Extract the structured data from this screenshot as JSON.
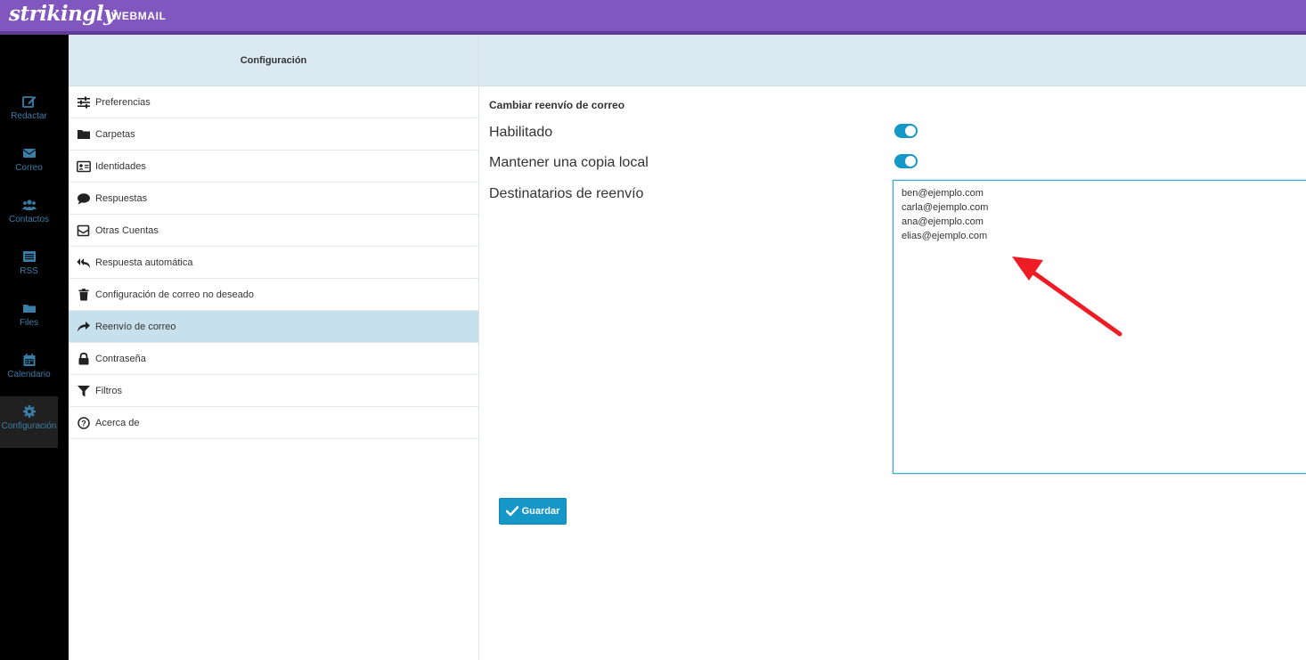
{
  "header": {
    "brand": "strikingly",
    "product": "WEBMAIL"
  },
  "colors": {
    "topbar": "#8157bf",
    "accent": "#1597c8",
    "selected_row": "#c7e1ec",
    "annotation_arrow": "#ee1c24"
  },
  "taskmenu": [
    {
      "label": "Redactar",
      "icon": "compose-icon"
    },
    {
      "label": "Correo",
      "icon": "envelope-icon"
    },
    {
      "label": "Contactos",
      "icon": "users-icon"
    },
    {
      "label": "RSS",
      "icon": "rss-icon"
    },
    {
      "label": "Files",
      "icon": "folder-icon"
    },
    {
      "label": "Calendario",
      "icon": "calendar-icon"
    },
    {
      "label": "Configuración",
      "icon": "gear-icon",
      "active": true
    }
  ],
  "settings": {
    "title": "Configuración",
    "items": [
      {
        "label": "Preferencias",
        "icon": "sliders-icon"
      },
      {
        "label": "Carpetas",
        "icon": "folder-icon"
      },
      {
        "label": "Identidades",
        "icon": "id-card-icon"
      },
      {
        "label": "Respuestas",
        "icon": "comment-icon"
      },
      {
        "label": "Otras Cuentas",
        "icon": "envelope-icon"
      },
      {
        "label": "Respuesta automática",
        "icon": "reply-all-icon"
      },
      {
        "label": "Configuración de correo no deseado",
        "icon": "trash-icon"
      },
      {
        "label": "Reenvío de correo",
        "icon": "share-icon",
        "active": true
      },
      {
        "label": "Contraseña",
        "icon": "lock-icon"
      },
      {
        "label": "Filtros",
        "icon": "filter-icon"
      },
      {
        "label": "Acerca de",
        "icon": "question-circle-icon"
      }
    ]
  },
  "form": {
    "title": "Cambiar reenvío de correo",
    "enabled_label": "Habilitado",
    "enabled": true,
    "keep_copy_label": "Mantener una copia local",
    "keep_copy": true,
    "recipients_label": "Destinatarios de reenvío",
    "recipients": "ben@ejemplo.com\ncarla@ejemplo.com\nana@ejemplo.com\nelias@ejemplo.com",
    "save_label": "Guardar"
  }
}
